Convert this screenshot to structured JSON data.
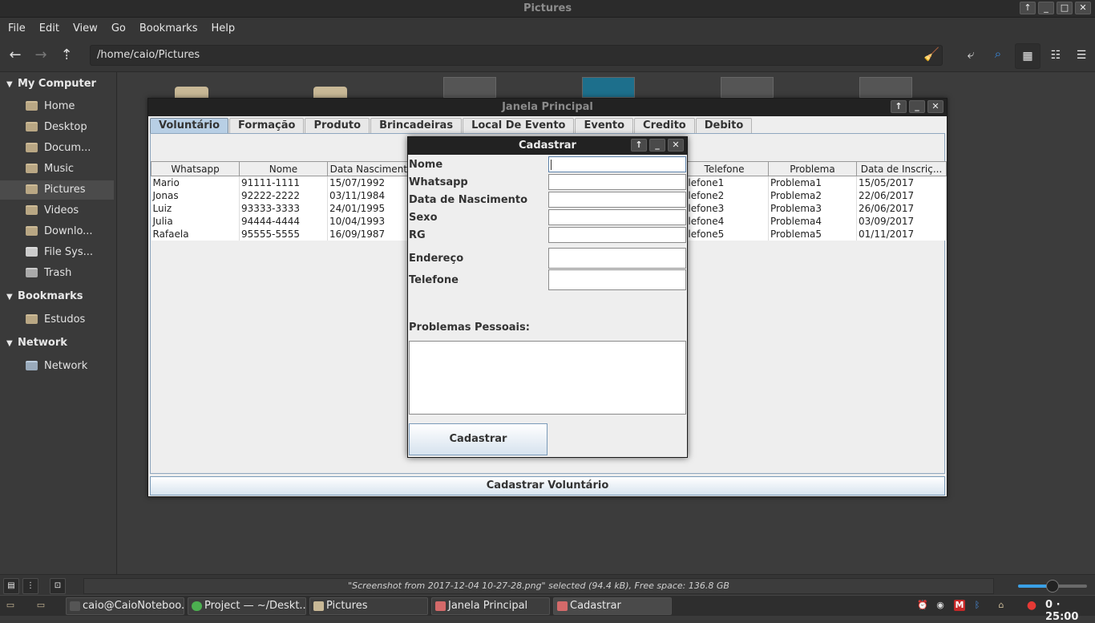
{
  "window": {
    "title": "Pictures"
  },
  "menu": [
    "File",
    "Edit",
    "View",
    "Go",
    "Bookmarks",
    "Help"
  ],
  "path": "/home/caio/Pictures",
  "sidebar": {
    "my_computer": "My Computer",
    "items": [
      "Home",
      "Desktop",
      "Docum...",
      "Music",
      "Pictures",
      "Videos",
      "Downlo...",
      "File Sys...",
      "Trash"
    ],
    "bookmarks": "Bookmarks",
    "bookmark_items": [
      "Estudos"
    ],
    "network": "Network",
    "network_items": [
      "Network"
    ]
  },
  "status": "\"Screenshot from 2017-12-04 10-27-28.png\" selected (94.4 kB), Free space: 136.8 GB",
  "zoom_level": 0.5,
  "taskbar": {
    "tasks": [
      "caio@CaioNoteboo...",
      "Project — ~/Deskt...",
      "Pictures",
      "Janela Principal",
      "Cadastrar"
    ],
    "clock": "0 · 25:00"
  },
  "janela": {
    "title": "Janela Principal",
    "tabs": [
      "Voluntário",
      "Formação",
      "Produto",
      "Brincadeiras",
      "Local De Evento",
      "Evento",
      "Credito",
      "Debito"
    ],
    "columns": [
      "Whatsapp",
      "Nome",
      "Data Nascimento",
      "",
      "",
      "",
      "Telefone",
      "Problema",
      "Data de Inscriç..."
    ],
    "rows": [
      [
        "Mario",
        "91111-1111",
        "15/07/1992",
        "",
        "",
        "",
        "elefone1",
        "Problema1",
        "15/05/2017"
      ],
      [
        "Jonas",
        "92222-2222",
        "03/11/1984",
        "",
        "",
        "",
        "elefone2",
        "Problema2",
        "22/06/2017"
      ],
      [
        "Luiz",
        "93333-3333",
        "24/01/1995",
        "",
        "",
        "",
        "elefone3",
        "Problema3",
        "26/06/2017"
      ],
      [
        "Julia",
        "94444-4444",
        "10/04/1993",
        "",
        "",
        "",
        "elefone4",
        "Problema4",
        "03/09/2017"
      ],
      [
        "Rafaela",
        "95555-5555",
        "16/09/1987",
        "",
        "",
        "",
        "elefone5",
        "Problema5",
        "01/11/2017"
      ]
    ],
    "button": "Cadastrar Voluntário"
  },
  "dialog": {
    "title": "Cadastrar",
    "fields": [
      "Nome",
      "Whatsapp",
      "Data de Nascimento",
      "Sexo",
      "RG",
      "Endereço",
      "Telefone"
    ],
    "problems_label": "Problemas Pessoais:",
    "button": "Cadastrar"
  }
}
